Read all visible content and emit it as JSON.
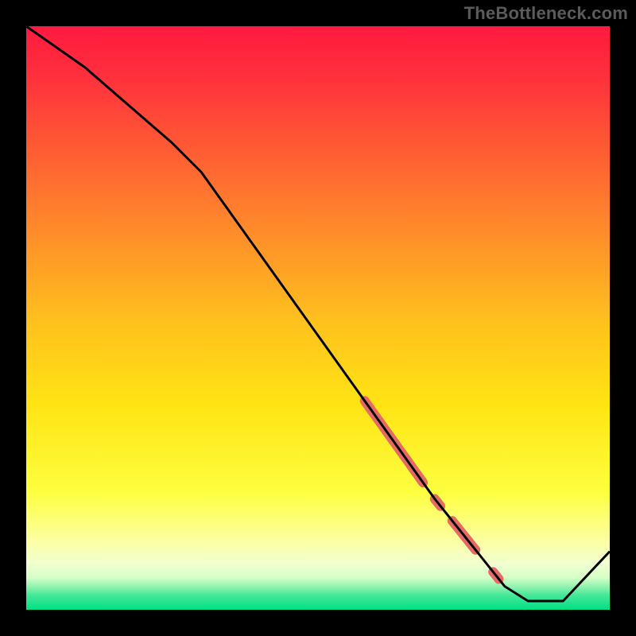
{
  "watermark": "TheBottleneck.com",
  "chart_data": {
    "type": "line",
    "xlabel": "",
    "ylabel": "",
    "xlim": [
      0,
      100
    ],
    "ylim": [
      0,
      100
    ],
    "title": "",
    "background_gradient": {
      "top": "#ff1a3f",
      "mid1": "#ff8a2a",
      "mid2": "#ffe414",
      "low": "#ffff8e",
      "bottom": "#00e084"
    },
    "line": {
      "color": "#000000",
      "points_xy": [
        [
          0,
          100
        ],
        [
          10,
          93
        ],
        [
          25,
          80
        ],
        [
          30,
          75
        ],
        [
          40,
          61
        ],
        [
          55,
          40
        ],
        [
          70,
          19
        ],
        [
          82,
          4
        ],
        [
          86,
          1.5
        ],
        [
          92,
          1.5
        ],
        [
          100,
          10
        ]
      ]
    },
    "highlight_segments": {
      "color": "#e66a64",
      "segments_x_range": [
        [
          58,
          68
        ],
        [
          70,
          71
        ],
        [
          73,
          77
        ],
        [
          80,
          81
        ]
      ]
    }
  }
}
